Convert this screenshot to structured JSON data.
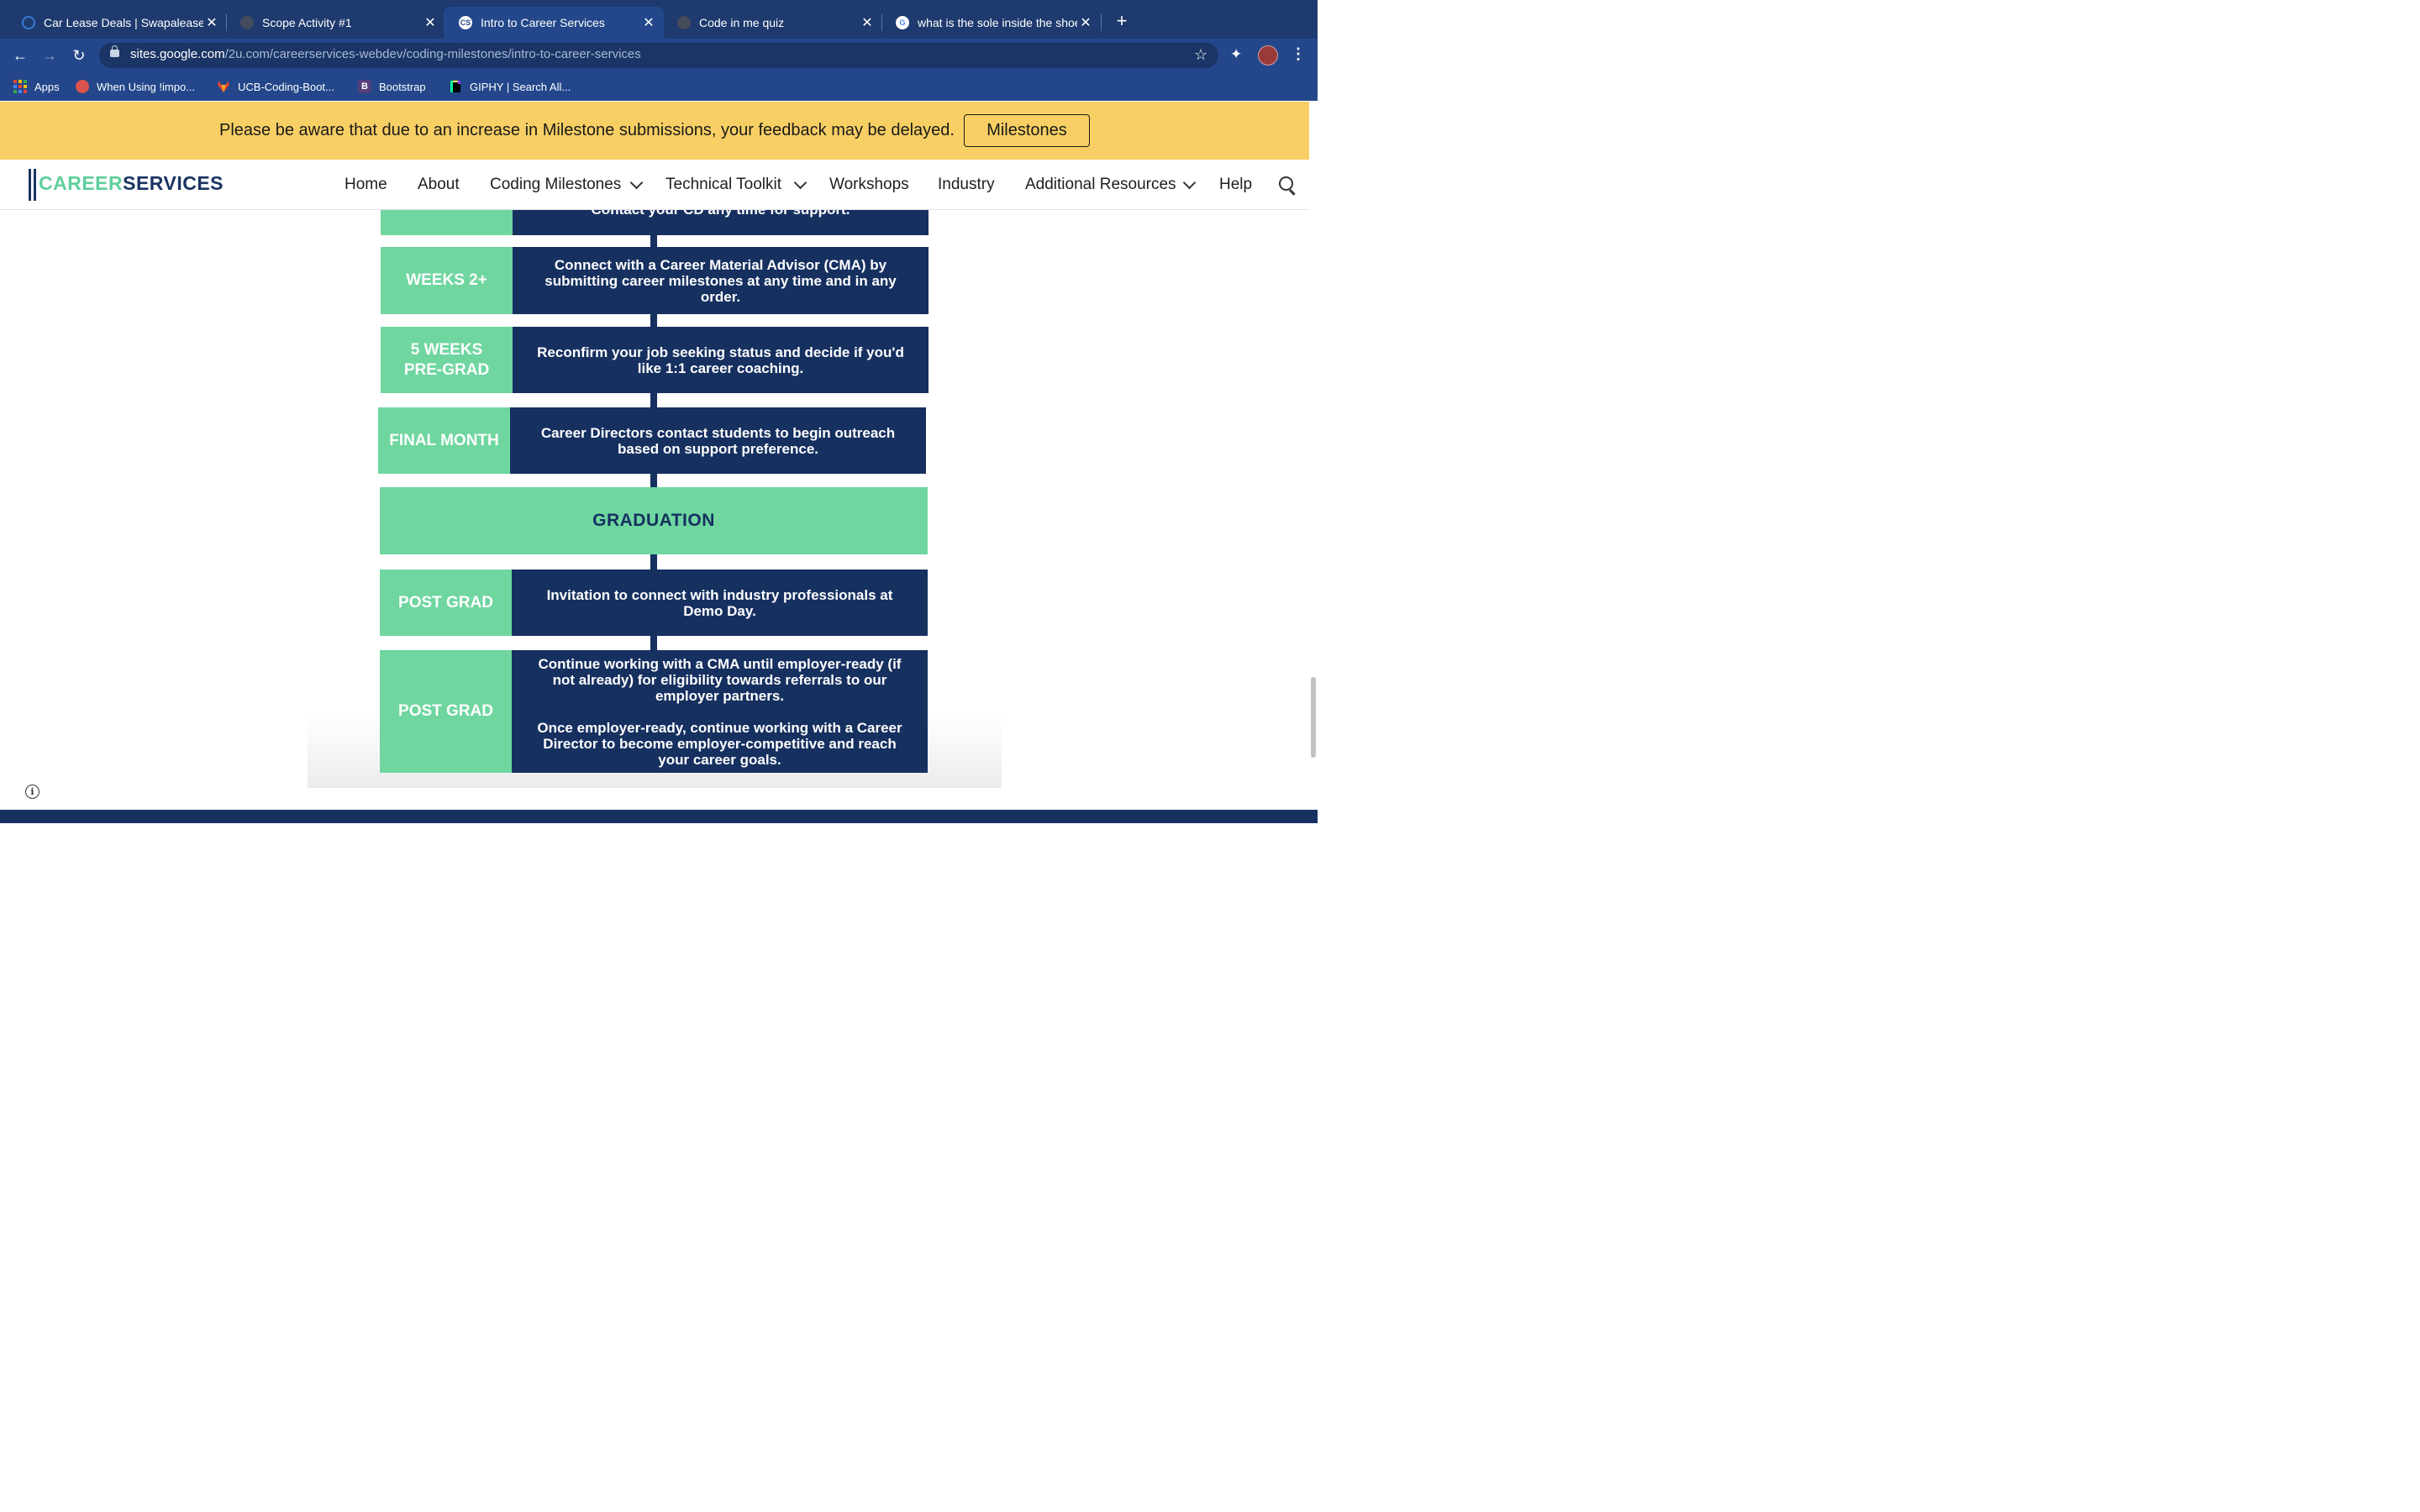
{
  "browser": {
    "tabs": [
      {
        "title": "Car Lease Deals | Swapalease.c",
        "close": "✕",
        "favicon_color": "#3a7bd5"
      },
      {
        "title": "Scope Activity #1",
        "close": "✕",
        "favicon_color": "#444c5c"
      },
      {
        "title": "Intro to Career Services",
        "close": "✕",
        "favicon_color": "#ffffff",
        "favicon_text": "CS"
      },
      {
        "title": "Code in me quiz",
        "close": "✕",
        "favicon_color": "#444c5c"
      },
      {
        "title": "what is the sole inside the shoe",
        "close": "✕",
        "favicon_color": "#ffffff",
        "favicon_text": "G"
      }
    ],
    "new_tab": "+",
    "url_host": "sites.google.com",
    "url_path": "/2u.com/careerservices-webdev/coding-milestones/intro-to-career-services",
    "bookmarks": [
      {
        "label": "Apps",
        "icon": "apps-grid-icon"
      },
      {
        "label": "When Using !impo...",
        "icon": "circle-icon"
      },
      {
        "label": "UCB-Coding-Boot...",
        "icon": "gitlab-icon"
      },
      {
        "label": "Bootstrap",
        "icon": "bootstrap-icon",
        "glyph": "B"
      },
      {
        "label": "GIPHY | Search All...",
        "icon": "giphy-icon"
      }
    ]
  },
  "banner": {
    "text": "Please be aware that due to an increase in Milestone submissions, your feedback may be delayed.",
    "button": "Milestones"
  },
  "site": {
    "logo_part1": "CAREER",
    "logo_part2": "SERVICES",
    "nav": [
      {
        "label": "Home"
      },
      {
        "label": "About"
      },
      {
        "label": "Coding Milestones"
      },
      {
        "label": "Technical Toolkit"
      },
      {
        "label": "Workshops"
      },
      {
        "label": "Industry"
      },
      {
        "label": "Additional Resources"
      },
      {
        "label": "Help"
      }
    ]
  },
  "timeline": {
    "top_partial": "Contact your CD any time for support.",
    "rows": [
      {
        "label": "WEEKS 2+",
        "text": "Connect with a Career Material Advisor (CMA) by submitting career milestones at any time and in any order."
      },
      {
        "label": "5 WEEKS\nPRE-GRAD",
        "text": "Reconfirm your job seeking status and decide if you'd like 1:1 career coaching."
      },
      {
        "label": "FINAL MONTH",
        "text": "Career Directors contact students to begin outreach based on support preference."
      },
      {
        "label": "POST GRAD",
        "text": "Invitation to connect with industry professionals at Demo Day."
      },
      {
        "label": "POST GRAD",
        "text": "Continue working with a CMA until employer-ready (if not already) for eligibility towards referrals to our employer partners.\n\nOnce employer-ready, continue working with a Career Director to become employer-competitive and reach your career goals."
      }
    ],
    "graduation": "GRADUATION"
  },
  "colors": {
    "navy": "#163060",
    "mint": "#6fd6a0",
    "banner": "#f8cf64",
    "chrome": "#23478a"
  }
}
